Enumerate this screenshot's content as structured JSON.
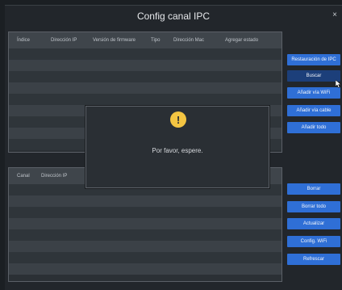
{
  "window": {
    "title": "Config canal IPC",
    "close": "×"
  },
  "upper_table": {
    "headers": [
      "Índice",
      "Dirección IP",
      "Versión de firmware",
      "Tipo",
      "Dirección Mac",
      "Agregar estado"
    ]
  },
  "lower_table": {
    "headers": [
      "Canal",
      "Dirección IP"
    ]
  },
  "side_buttons_top": [
    "Restauración de IPC",
    "Buscar",
    "Añadir vía WiFi",
    "Añadir vía cable",
    "Añadir todo"
  ],
  "side_buttons_bottom": [
    "Borrar",
    "Borrar todo",
    "Actualizar",
    "Config. WiFi",
    "Refrescar"
  ],
  "dialog": {
    "message": "Por favor, espere.",
    "icon": "warning-icon"
  },
  "colors": {
    "button_blue": "#2f6fd6",
    "button_active": "#1c3f7a",
    "warning_yellow": "#f4c542"
  }
}
